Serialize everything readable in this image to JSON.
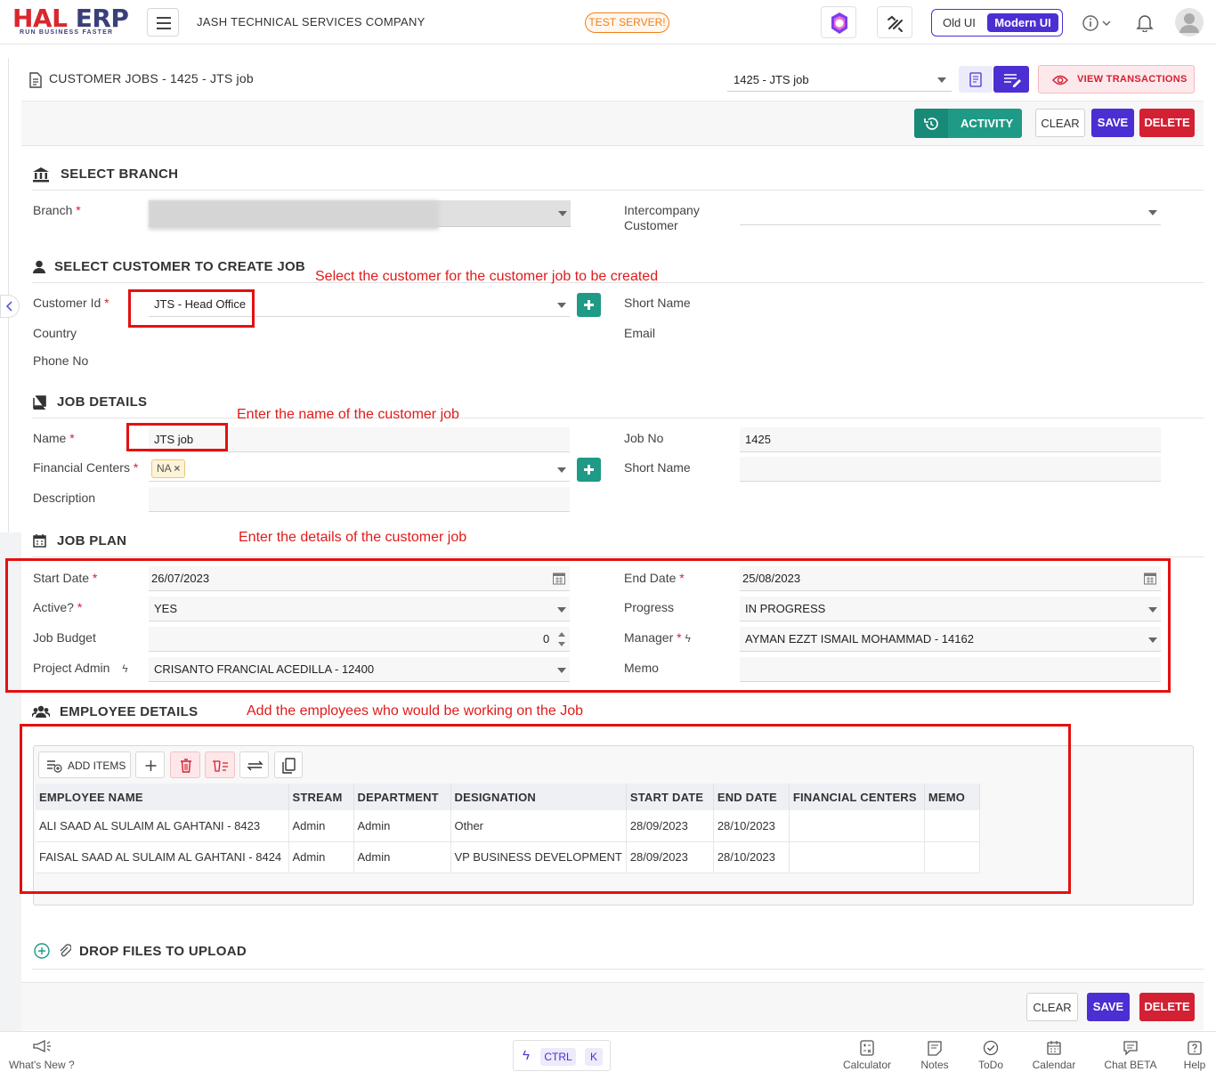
{
  "topbar": {
    "logo_hal": "HAL",
    "logo_erp": "ERP",
    "logo_tagline": "RUN BUSINESS FASTER",
    "company": "JASH TECHNICAL SERVICES COMPANY",
    "server_badge": "TEST SERVER!",
    "old_ui": "Old UI",
    "modern_ui": "Modern UI"
  },
  "header": {
    "title": "CUSTOMER JOBS - 1425 - JTS job",
    "record_select": "1425 - JTS job",
    "view_transactions": "VIEW TRANSACTIONS"
  },
  "actions": {
    "activity": "ACTIVITY",
    "clear": "CLEAR",
    "save": "SAVE",
    "delete": "DELETE"
  },
  "branch_section": {
    "title": "SELECT BRANCH",
    "branch_label": "Branch",
    "intercompany_label_1": "Intercompany",
    "intercompany_label_2": "Customer"
  },
  "customer_section": {
    "title": "SELECT CUSTOMER TO CREATE JOB",
    "customer_id_label": "Customer Id",
    "customer_id_value": "JTS - Head Office",
    "short_name_label": "Short Name",
    "country_label": "Country",
    "email_label": "Email",
    "phone_label": "Phone No"
  },
  "job_details": {
    "title": "JOB DETAILS",
    "name_label": "Name",
    "name_value": "JTS job",
    "job_no_label": "Job No",
    "job_no_value": "1425",
    "financial_centers_label": "Financial Centers",
    "financial_center_tag": "NA",
    "short_name_label": "Short Name",
    "description_label": "Description"
  },
  "job_plan": {
    "title": "JOB PLAN",
    "start_date_label": "Start Date",
    "start_date_value": "26/07/2023",
    "end_date_label": "End Date",
    "end_date_value": "25/08/2023",
    "active_label": "Active?",
    "active_value": "YES",
    "progress_label": "Progress",
    "progress_value": "IN PROGRESS",
    "budget_label": "Job Budget",
    "budget_value": "0",
    "manager_label": "Manager",
    "manager_value": "AYMAN EZZT ISMAIL  MOHAMMAD - 14162",
    "project_admin_label": "Project Admin",
    "project_admin_value": "CRISANTO FRANCIAL  ACEDILLA - 12400",
    "memo_label": "Memo"
  },
  "employees": {
    "title": "EMPLOYEE DETAILS",
    "add_items": "ADD ITEMS",
    "columns": [
      "EMPLOYEE NAME",
      "STREAM",
      "DEPARTMENT",
      "DESIGNATION",
      "START DATE",
      "END DATE",
      "FINANCIAL CENTERS",
      "MEMO"
    ],
    "rows": [
      [
        "ALI SAAD AL SULAIM AL GAHTANI - 8423",
        "Admin",
        "Admin",
        "Other",
        "28/09/2023",
        "28/10/2023",
        "",
        ""
      ],
      [
        "FAISAL SAAD AL SULAIM AL GAHTANI - 8424",
        "Admin",
        "Admin",
        "VP BUSINESS DEVELOPMENT",
        "28/09/2023",
        "28/10/2023",
        "",
        ""
      ]
    ]
  },
  "files": {
    "title": "DROP FILES TO UPLOAD"
  },
  "annotations": {
    "customer": "Select the customer for the customer job to be created",
    "name": "Enter the name of the customer job",
    "plan": "Enter the details of the customer job",
    "employees": "Add the employees who would be working on the Job"
  },
  "bottombar": {
    "whats_new": "What's New ?",
    "ctrl": "CTRL",
    "k": "K",
    "calculator": "Calculator",
    "notes": "Notes",
    "todo": "ToDo",
    "calendar": "Calendar",
    "chat": "Chat BETA",
    "help": "Help"
  },
  "colors": {
    "accent": "#4c2fd2",
    "teal": "#1e9a86",
    "danger": "#d32033",
    "annotation": "#e41010",
    "server_badge": "#f0801a"
  }
}
